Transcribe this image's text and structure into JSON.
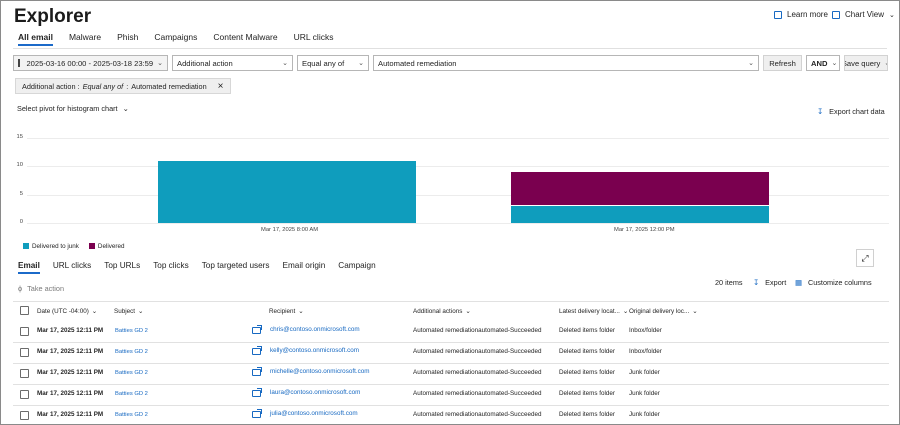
{
  "header": {
    "title": "Explorer",
    "learn_more": "Learn more",
    "chart_view": "Chart View"
  },
  "tabs": [
    "All email",
    "Malware",
    "Phish",
    "Campaigns",
    "Content Malware",
    "URL clicks"
  ],
  "filters": {
    "date_range": "2025-03-16 00:00 - 2025-03-18 23:59",
    "field": "Additional action",
    "operator": "Equal any of",
    "value": "Automated remediation",
    "refresh": "Refresh",
    "logic": "AND",
    "save_query": "Save query"
  },
  "active_filter": {
    "field": "Additional action :",
    "operator": "Equal any of",
    "sep": ":",
    "value": "Automated remediation"
  },
  "pivot": {
    "label": "Select pivot for histogram chart"
  },
  "export_chart": "Export chart data",
  "chart_data": {
    "type": "bar",
    "stacked": true,
    "categories": [
      "Mar 17, 2025 8:00 AM",
      "Mar 17, 2025 12:00 PM"
    ],
    "series": [
      {
        "name": "Delivered to junk",
        "values": [
          11,
          3
        ],
        "color": "#0f9dbd"
      },
      {
        "name": "Delivered",
        "values": [
          0,
          6
        ],
        "color": "#7a004f"
      }
    ],
    "yticks": [
      "15",
      "10",
      "5",
      "0"
    ],
    "ylim": [
      0,
      15
    ],
    "grid": true,
    "legend_position": "bottom-left"
  },
  "detail_tabs": [
    "Email",
    "URL clicks",
    "Top URLs",
    "Top clicks",
    "Top targeted users",
    "Email origin",
    "Campaign"
  ],
  "take_action": "Take action",
  "toolbar": {
    "items_count": "20 items",
    "export": "Export",
    "customize": "Customize columns"
  },
  "columns": {
    "date": "Date (UTC -04:00)",
    "subject": "Subject",
    "recipient": "Recipient",
    "additional_actions": "Additional actions",
    "latest_location": "Latest delivery locat...",
    "original_location": "Original delivery loc..."
  },
  "rows": [
    {
      "date": "Mar 17, 2025 12:11 PM",
      "subject": "Batties GD 2",
      "recipient": "chris@contoso.onmicrosoft.com",
      "actions": "Automated remediationautomated-Succeeded",
      "latest": "Deleted items folder",
      "original": "Inbox/folder"
    },
    {
      "date": "Mar 17, 2025 12:11 PM",
      "subject": "Batties GD 2",
      "recipient": "kelly@contoso.onmicrosoft.com",
      "actions": "Automated remediationautomated-Succeeded",
      "latest": "Deleted items folder",
      "original": "Inbox/folder"
    },
    {
      "date": "Mar 17, 2025 12:11 PM",
      "subject": "Batties GD 2",
      "recipient": "michelle@contoso.onmicrosoft.com",
      "actions": "Automated remediationautomated-Succeeded",
      "latest": "Deleted items folder",
      "original": "Junk folder"
    },
    {
      "date": "Mar 17, 2025 12:11 PM",
      "subject": "Batties GD 2",
      "recipient": "laura@contoso.onmicrosoft.com",
      "actions": "Automated remediationautomated-Succeeded",
      "latest": "Deleted items folder",
      "original": "Junk folder"
    },
    {
      "date": "Mar 17, 2025 12:11 PM",
      "subject": "Batties GD 2",
      "recipient": "julia@contoso.onmicrosoft.com",
      "actions": "Automated remediationautomated-Succeeded",
      "latest": "Deleted items folder",
      "original": "Junk folder"
    }
  ]
}
